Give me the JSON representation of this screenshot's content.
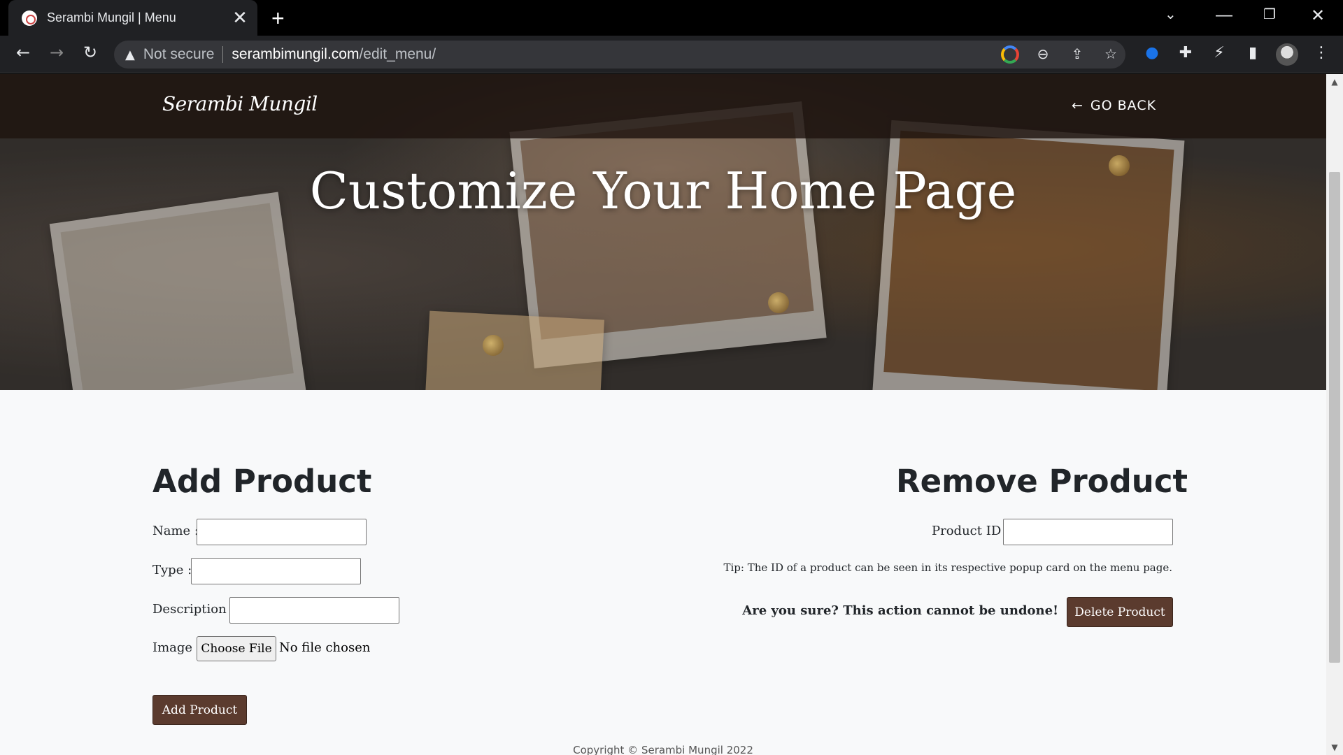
{
  "browser": {
    "tab_title": "Serambi Mungil | Menu",
    "tab_close": "✕",
    "new_tab": "+",
    "not_secure": "Not secure",
    "url_host": "serambimungil.com",
    "url_path": "/edit_menu/"
  },
  "navbar": {
    "brand": "Serambi Mungil",
    "go_back": "GO BACK"
  },
  "hero": {
    "title": "Customize Your Home Page"
  },
  "add_product": {
    "title": "Add Product",
    "name_label": "Name :",
    "type_label": "Type :",
    "description_label": "Description :",
    "image_label": "Image :",
    "choose_file": "Choose File",
    "no_file": "No file chosen",
    "submit": "Add Product"
  },
  "remove_product": {
    "title": "Remove Product",
    "product_id_label": "Product ID :",
    "tip": "Tip: The ID of a product can be seen in its respective popup card on the menu page.",
    "warning": "Are you sure? This action cannot be undone!",
    "delete": "Delete Product"
  },
  "footer": {
    "copyright": "Copyright © Serambi Mungil 2022"
  }
}
